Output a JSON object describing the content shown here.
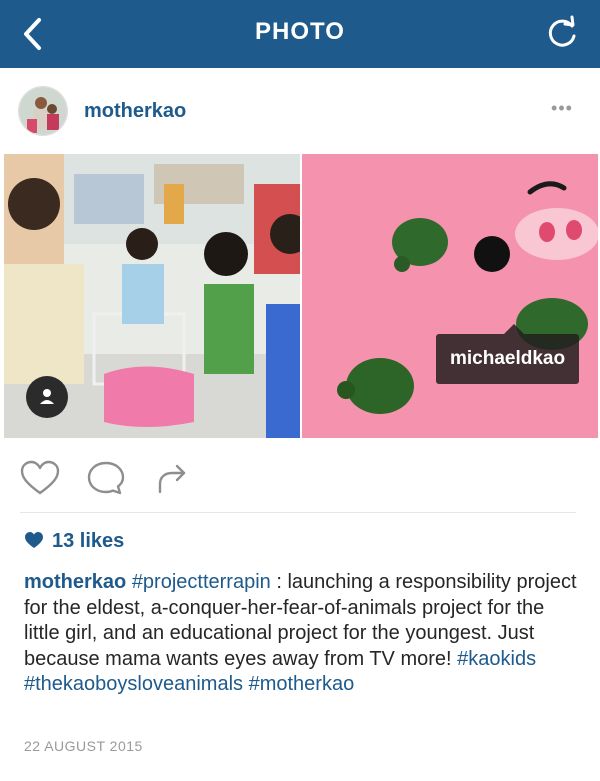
{
  "nav": {
    "title": "PHOTO",
    "back_icon": "chevron-left-icon",
    "refresh_icon": "refresh-icon"
  },
  "post": {
    "username": "motherkao",
    "more_label": "•••",
    "tagged_user": "michaeldkao",
    "likes_count": "13 likes",
    "caption": {
      "username": "motherkao",
      "hashtag_1": "#projectterrapin",
      "text": " : launching a responsibility project for the eldest, a-conquer-her-fear-of-animals project for the little girl, and an educational project for the youngest. Just because mama wants eyes away from TV more! ",
      "hashtag_2": "#kaokids",
      "hashtag_3": "#thekaoboysloveanimals",
      "hashtag_4": "#motherkao"
    },
    "date": "22 AUGUST 2015"
  },
  "colors": {
    "brand": "#1e5a8c",
    "muted": "#9a9a9a",
    "text": "#262626"
  }
}
